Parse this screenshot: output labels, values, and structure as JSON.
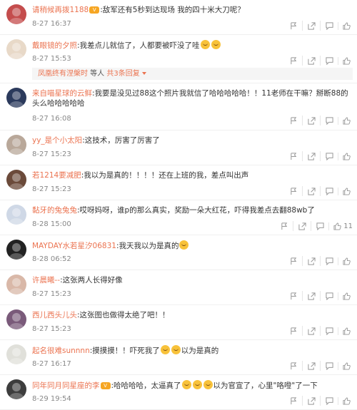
{
  "actions": {
    "report_icon": "report-icon",
    "share_icon": "share-icon",
    "comment_icon": "comment-icon",
    "like_icon": "like-icon"
  },
  "comments": [
    {
      "user": "请稍候再拨1188",
      "badge": "vip",
      "text": "敌军还有5秒到达现场 我的四十米大刀呢？",
      "time": "8-27 16:37",
      "likes": "",
      "avatar_color": "#c44d4d"
    },
    {
      "user": "戴眼镜的夕照",
      "text": "我差点儿就信了，人都要被吓没了哇",
      "emojis_after": 2,
      "time": "8-27 15:53",
      "likes": "",
      "avatar_color": "#e8d9c8",
      "replies": {
        "name": "凤凰终有涅槃时",
        "middle": " 等人 ",
        "link": "共3条回复"
      }
    },
    {
      "user": "来自喵星球的云鲜",
      "text": "我要是没见过88这个照片我就信了哈哈哈哈哈！！11老师在干嘛？掰断88的头么哈哈哈哈哈",
      "time": "8-27 16:08",
      "likes": "",
      "avatar_color": "#2b3a5c",
      "wrap": true
    },
    {
      "user": "yy_是个小太阳",
      "text": "这技术，厉害了厉害了",
      "time": "8-27 15:23",
      "likes": "",
      "avatar_color": "#b9a89a"
    },
    {
      "user": "若1214要减肥",
      "text": "我以为是真的！！！！还在上班的我，差点叫出声",
      "time": "8-27 15:23",
      "likes": "",
      "avatar_color": "#6b4a3a"
    },
    {
      "user": "黏牙的兔兔兔",
      "text": "哎呀妈呀，谁p的那么真实，奖励一朵大红花，吓得我差点去翻88wb了",
      "time": "8-28 15:00",
      "likes": "11",
      "avatar_color": "#cfd8e6"
    },
    {
      "user": "MAYDAY水若星汐06831",
      "text": "我天我以为是真的",
      "emojis_after": 1,
      "time": "8-28 06:52",
      "likes": "",
      "avatar_color": "#222222"
    },
    {
      "user": "许晨曦--",
      "text": "这张两人长得好像",
      "time": "8-27 15:23",
      "likes": "",
      "avatar_color": "#d9b8a8"
    },
    {
      "user": "西儿西头儿头",
      "text": "这张图也做得太绝了吧！！",
      "time": "8-27 15:23",
      "likes": "",
      "avatar_color": "#7a5a7a"
    },
    {
      "user": "起名很难sunnnn",
      "text": "摸摸摸！！吓死我了",
      "emojis_mid": 2,
      "text2": "以为是真的",
      "time": "8-27 16:17",
      "likes": "",
      "avatar_color": "#e0e0da"
    },
    {
      "user": "同年同月同星座的李",
      "badge": "vip",
      "text": "哈哈哈哈，太逼真了",
      "emojis_mid": 3,
      "text2": "以为官宣了，心里\"咯噔\"了一下",
      "time": "8-29 19:54",
      "likes": "",
      "avatar_color": "#3d3d3d"
    }
  ]
}
